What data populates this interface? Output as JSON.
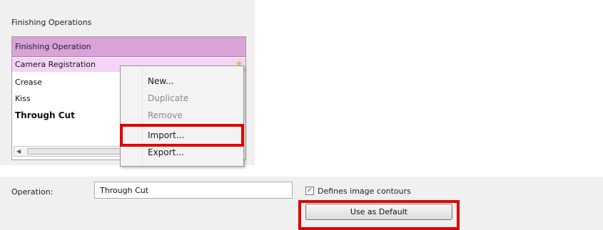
{
  "finishing_operations": {
    "group_title": "Finishing Operations",
    "column_header": "Finishing Operation",
    "rows": [
      {
        "label": "Camera Registration"
      },
      {
        "label": "Crease"
      },
      {
        "label": "Kiss"
      },
      {
        "label": "Through Cut"
      }
    ]
  },
  "context_menu": {
    "items": [
      {
        "label": "New...",
        "enabled": true
      },
      {
        "label": "Duplicate",
        "enabled": false
      },
      {
        "label": "Remove",
        "enabled": false
      },
      {
        "label": "Import...",
        "enabled": true
      },
      {
        "label": "Export...",
        "enabled": true
      }
    ]
  },
  "operation": {
    "label": "Operation:",
    "value": "Through Cut",
    "defines_contours_label": "Defines image contours",
    "defines_contours_checked": true,
    "use_default_label": "Use as Default"
  },
  "icons": {
    "busy_cursor": "busy-cursor-icon",
    "scroll_left": "arrow-left-icon",
    "scroll_down": "arrow-down-icon",
    "checkmark": "checkmark-icon"
  },
  "colors": {
    "header_bg": "#d9a2d9",
    "selected_row_bg": "#f4d4f4",
    "highlight": "#e00000"
  }
}
